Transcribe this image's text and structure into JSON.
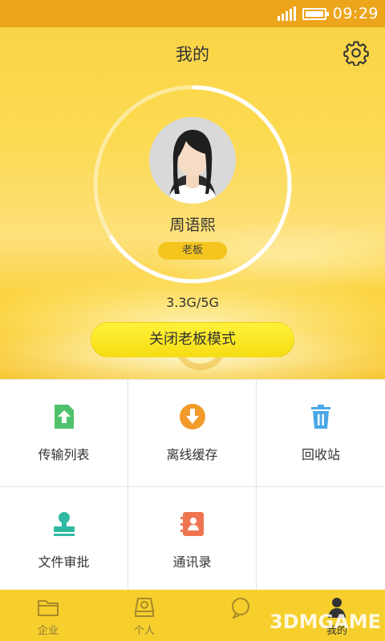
{
  "status_bar": {
    "time": "09:29"
  },
  "header": {
    "title": "我的",
    "settings_icon": "gear-icon"
  },
  "profile": {
    "name": "周语熙",
    "role": "老板",
    "storage_used": "3.3G",
    "storage_total": "5G",
    "storage_text": "3.3G/5G",
    "storage_fraction": 0.66,
    "boss_mode_button": "关闭老板模式"
  },
  "grid": {
    "items": [
      {
        "label": "传输列表",
        "icon": "upload-file-icon",
        "color": "#4fc36b"
      },
      {
        "label": "离线缓存",
        "icon": "download-circle-icon",
        "color": "#f29b2b"
      },
      {
        "label": "回收站",
        "icon": "trash-icon",
        "color": "#4aa8e8"
      },
      {
        "label": "文件审批",
        "icon": "approval-stamp-icon",
        "color": "#2fb9a3"
      },
      {
        "label": "通讯录",
        "icon": "contacts-book-icon",
        "color": "#ef7550"
      }
    ]
  },
  "bottom_nav": {
    "items": [
      {
        "label": "企业",
        "icon": "folder-icon"
      },
      {
        "label": "个人",
        "icon": "drive-icon"
      },
      {
        "label": "",
        "icon": "chat-icon"
      },
      {
        "label": "我的",
        "icon": "person-icon",
        "active": true
      }
    ]
  },
  "watermark": "3DMGAME",
  "colors": {
    "accent": "#f6cf2d",
    "status_bar": "#eda51c",
    "badge": "#f5c51e"
  }
}
